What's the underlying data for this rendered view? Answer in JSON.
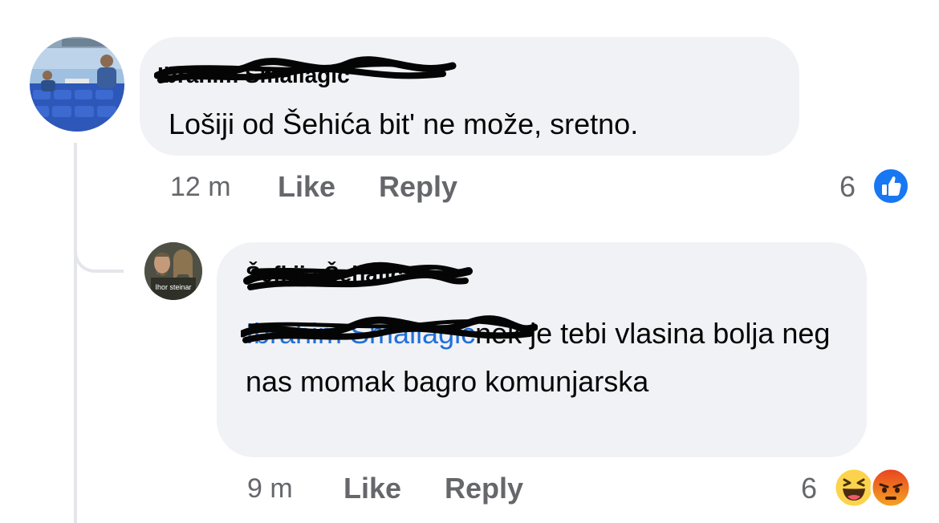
{
  "comments": [
    {
      "author": "Ibrahim Smailagić",
      "text": "Lošiji od Šehića bit' ne može, sretno.",
      "time": "12 m",
      "like_label": "Like",
      "reply_label": "Reply",
      "reaction_count": "6",
      "reactions": [
        "like-icon"
      ]
    },
    {
      "author": "Šefkija Šehalić",
      "avatar_caption": "Ihor steinar",
      "mention": "Ibrahim Smailagić",
      "text": "nek je tebi vlasina bolja neg nas momak bagro komunjarska",
      "time": "9 m",
      "like_label": "Like",
      "reply_label": "Reply",
      "reaction_count": "6",
      "reactions": [
        "haha-icon",
        "angry-icon"
      ]
    }
  ],
  "colors": {
    "bubble": "#f0f2f5",
    "meta_text": "#65676b",
    "like_blue": "#1877f2",
    "mention_blue": "#216fdb"
  }
}
